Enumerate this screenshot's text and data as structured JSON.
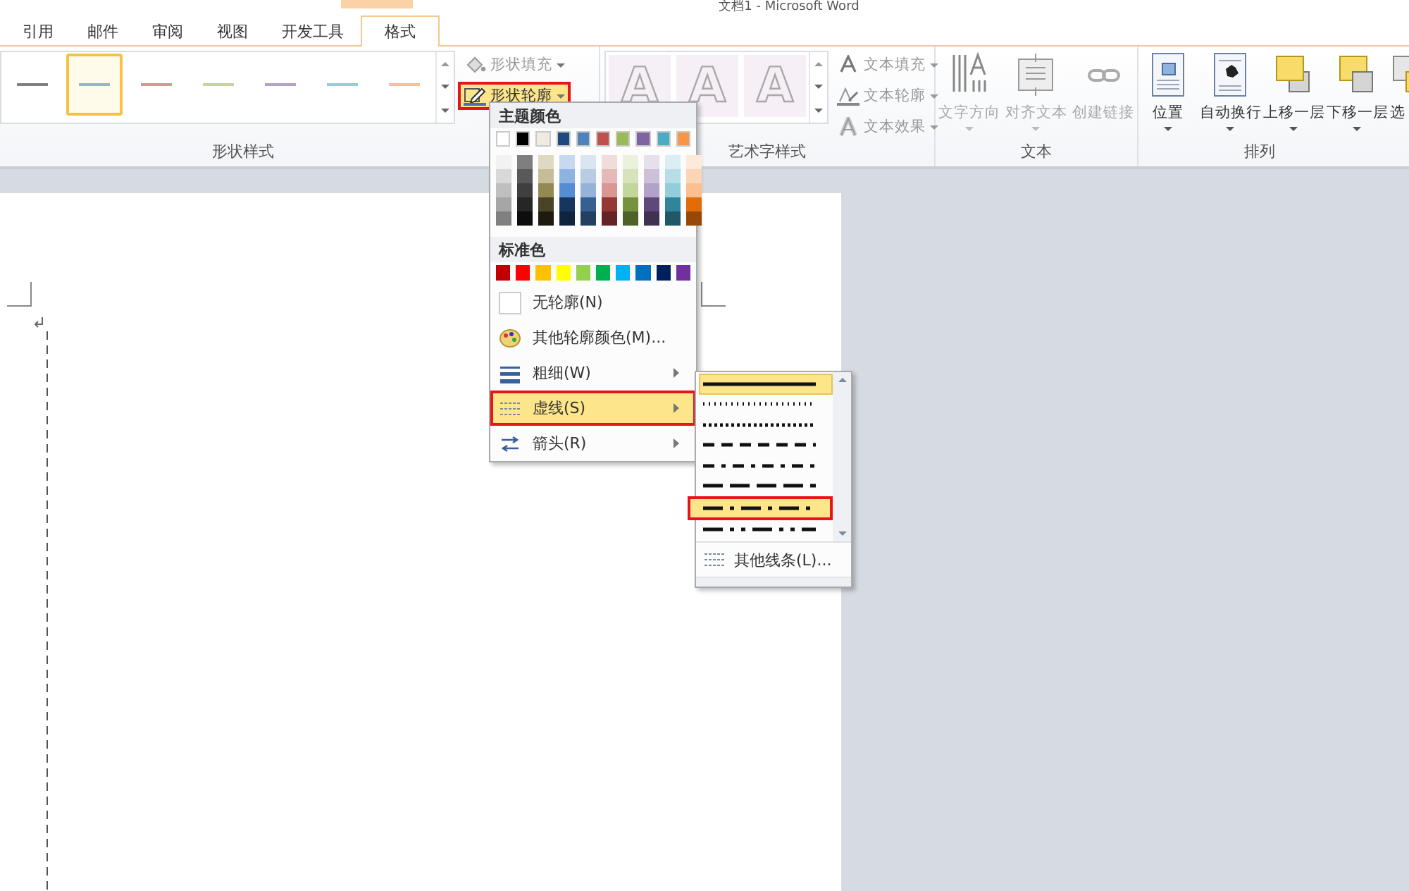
{
  "window": {
    "title": "文档1 - Microsoft Word"
  },
  "tabs": [
    {
      "label": "引用",
      "selected": false
    },
    {
      "label": "邮件",
      "selected": false
    },
    {
      "label": "审阅",
      "selected": false
    },
    {
      "label": "视图",
      "selected": false
    },
    {
      "label": "开发工具",
      "selected": false
    },
    {
      "label": "格式",
      "selected": true
    }
  ],
  "shape_styles": {
    "label": "形状样式",
    "styles": [
      {
        "color": "#7f7f7f",
        "selected": false
      },
      {
        "color": "#95b3d7",
        "selected": true
      },
      {
        "color": "#d99694",
        "selected": false
      },
      {
        "color": "#c3d69b",
        "selected": false
      },
      {
        "color": "#b2a2c7",
        "selected": false
      },
      {
        "color": "#92cddc",
        "selected": false
      },
      {
        "color": "#fac08f",
        "selected": false
      }
    ],
    "commands": [
      {
        "kind": "fill",
        "label": "形状填充",
        "selected": false
      },
      {
        "kind": "outline",
        "label": "形状轮廓",
        "selected": true
      }
    ]
  },
  "wordart": {
    "label": "艺术字样式",
    "previews": [
      "A",
      "A",
      "A"
    ],
    "commands": [
      {
        "kind": "fill",
        "label": "文本填充"
      },
      {
        "kind": "outline",
        "label": "文本轮廓"
      },
      {
        "kind": "effects",
        "label": "文本效果"
      }
    ]
  },
  "text_group": {
    "label": "文本",
    "commands": [
      {
        "kind": "direction",
        "label": "文字方向",
        "disabled": true
      },
      {
        "kind": "align",
        "label": "对齐文本",
        "disabled": true
      },
      {
        "kind": "link",
        "label": "创建链接",
        "disabled": true
      }
    ]
  },
  "arrange": {
    "label": "排列",
    "commands": [
      {
        "kind": "position",
        "label": "位置"
      },
      {
        "kind": "wrap",
        "label": "自动换行"
      },
      {
        "kind": "forward",
        "label": "上移一层"
      },
      {
        "kind": "backward",
        "label": "下移一层"
      },
      {
        "kind": "pane",
        "label": "选"
      }
    ]
  },
  "outline_menu": {
    "theme_heading": "主题颜色",
    "theme_colors": [
      {
        "shades": [
          {
            "color": "#ffffff"
          },
          {
            "color": "#f2f2f2"
          },
          {
            "color": "#d9d9d9"
          },
          {
            "color": "#bfbfbf"
          },
          {
            "color": "#a6a6a6"
          },
          {
            "color": "#808080"
          }
        ]
      },
      {
        "shades": [
          {
            "color": "#000000"
          },
          {
            "color": "#7f7f7f"
          },
          {
            "color": "#595959"
          },
          {
            "color": "#3f3f3f"
          },
          {
            "color": "#262626"
          },
          {
            "color": "#0d0d0d"
          }
        ]
      },
      {
        "shades": [
          {
            "color": "#eeece1"
          },
          {
            "color": "#ddd9c3"
          },
          {
            "color": "#c4bd97"
          },
          {
            "color": "#938953"
          },
          {
            "color": "#494429"
          },
          {
            "color": "#1d1b10"
          }
        ]
      },
      {
        "shades": [
          {
            "color": "#1f497d"
          },
          {
            "color": "#c6d9f0"
          },
          {
            "color": "#8db3e2"
          },
          {
            "color": "#548dd4"
          },
          {
            "color": "#17365d"
          },
          {
            "color": "#0f243e"
          }
        ]
      },
      {
        "shades": [
          {
            "color": "#4f81bd"
          },
          {
            "color": "#dbe5f1"
          },
          {
            "color": "#b8cce4"
          },
          {
            "color": "#95b3d7"
          },
          {
            "color": "#366092"
          },
          {
            "color": "#244061"
          }
        ]
      },
      {
        "shades": [
          {
            "color": "#c0504d"
          },
          {
            "color": "#f2dcdb"
          },
          {
            "color": "#e5b9b7"
          },
          {
            "color": "#d99694"
          },
          {
            "color": "#953734"
          },
          {
            "color": "#632423"
          }
        ]
      },
      {
        "shades": [
          {
            "color": "#9bbb59"
          },
          {
            "color": "#ebf1dd"
          },
          {
            "color": "#d7e3bc"
          },
          {
            "color": "#c3d69b"
          },
          {
            "color": "#76923c"
          },
          {
            "color": "#4f6128"
          }
        ]
      },
      {
        "shades": [
          {
            "color": "#8064a2"
          },
          {
            "color": "#e5e0ec"
          },
          {
            "color": "#ccc1d9"
          },
          {
            "color": "#b2a2c7"
          },
          {
            "color": "#5f497a"
          },
          {
            "color": "#3f3151"
          }
        ]
      },
      {
        "shades": [
          {
            "color": "#4bacc6"
          },
          {
            "color": "#dbeef3"
          },
          {
            "color": "#b7dde8"
          },
          {
            "color": "#92cddc"
          },
          {
            "color": "#31859b"
          },
          {
            "color": "#205867"
          }
        ]
      },
      {
        "shades": [
          {
            "color": "#f79646"
          },
          {
            "color": "#fdeada"
          },
          {
            "color": "#fbd5b5"
          },
          {
            "color": "#fac08f"
          },
          {
            "color": "#e36c09"
          },
          {
            "color": "#974806"
          }
        ]
      }
    ],
    "standard_heading": "标准色",
    "standard_colors": [
      {
        "color": "#c00000"
      },
      {
        "color": "#ff0000"
      },
      {
        "color": "#ffc000"
      },
      {
        "color": "#ffff00"
      },
      {
        "color": "#92d050"
      },
      {
        "color": "#00b050"
      },
      {
        "color": "#00b0f0"
      },
      {
        "color": "#0070c0"
      },
      {
        "color": "#002060"
      },
      {
        "color": "#7030a0"
      }
    ],
    "items": [
      {
        "kind": "none",
        "label": "无轮廓(N)",
        "submenu": false,
        "selected": false
      },
      {
        "kind": "palette",
        "label": "其他轮廓颜色(M)...",
        "submenu": false,
        "selected": false
      },
      {
        "kind": "weight",
        "label": "粗细(W)",
        "submenu": true,
        "selected": false
      },
      {
        "kind": "dashes",
        "label": "虚线(S)",
        "submenu": true,
        "selected": true
      },
      {
        "kind": "arrows",
        "label": "箭头(R)",
        "submenu": true,
        "selected": false
      }
    ]
  },
  "dash_menu": {
    "items": [
      {
        "kind": "solid",
        "current": true,
        "selected": false
      },
      {
        "kind": "round-dot",
        "current": false,
        "selected": false
      },
      {
        "kind": "square-dot",
        "current": false,
        "selected": false
      },
      {
        "kind": "dash",
        "current": false,
        "selected": false
      },
      {
        "kind": "dash-dot",
        "current": false,
        "selected": false
      },
      {
        "kind": "long-dash",
        "current": false,
        "selected": false
      },
      {
        "kind": "long-dash-dot",
        "current": false,
        "selected": true
      },
      {
        "kind": "long-dash-dot-dot",
        "current": false,
        "selected": false
      }
    ],
    "more": "其他线条(L)..."
  }
}
